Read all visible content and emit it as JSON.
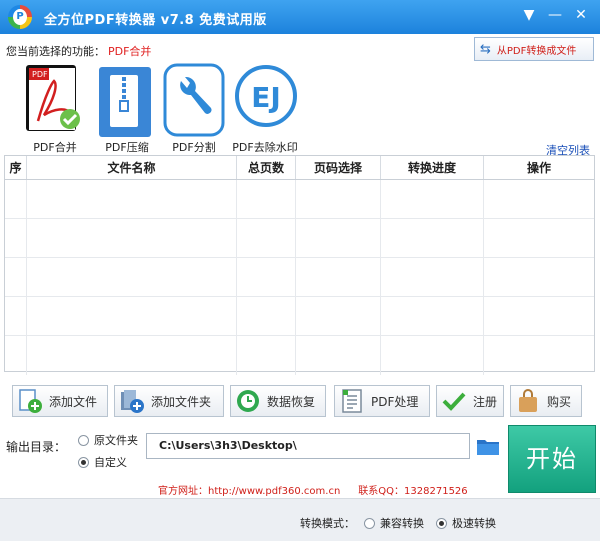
{
  "window": {
    "title": "全方位PDF转换器 v7.8 免费试用版",
    "dropdown_glyph": "▼",
    "minimize_glyph": "—",
    "close_glyph": "✕"
  },
  "function_bar": {
    "label": "您当前选择的功能：",
    "selected": "PDF合并",
    "from_pdf_button": "从PDF转换成文件"
  },
  "tools": [
    {
      "label": "PDF合并",
      "icon": "pdf-merge-icon"
    },
    {
      "label": "PDF压缩",
      "icon": "pdf-compress-icon"
    },
    {
      "label": "PDF分割",
      "icon": "wrench-icon"
    },
    {
      "label": "PDF去除水印",
      "icon": "watermark-remove-icon"
    }
  ],
  "clear_list": "清空列表",
  "table": {
    "columns": [
      "序",
      "文件名称",
      "总页数",
      "页码选择",
      "转换进度",
      "操作"
    ]
  },
  "actions": {
    "add_file": "添加文件",
    "add_folder": "添加文件夹",
    "data_recover": "数据恢复",
    "pdf_process": "PDF处理",
    "register": "注册",
    "buy": "购买"
  },
  "output": {
    "label": "输出目录：",
    "option_original": "原文件夹",
    "option_custom": "自定义",
    "path": "C:\\Users\\3h3\\Desktop\\",
    "start": "开始"
  },
  "site": {
    "website": "官方网址：http://www.pdf360.com.cn",
    "qq": "联系QQ：1328271526"
  },
  "mode": {
    "label": "转换模式：",
    "compatible": "兼容转换",
    "fast": "极速转换"
  },
  "colors": {
    "accent": "#1c82dc",
    "selected_function": "#e02020",
    "start_button": "#13a17e"
  }
}
